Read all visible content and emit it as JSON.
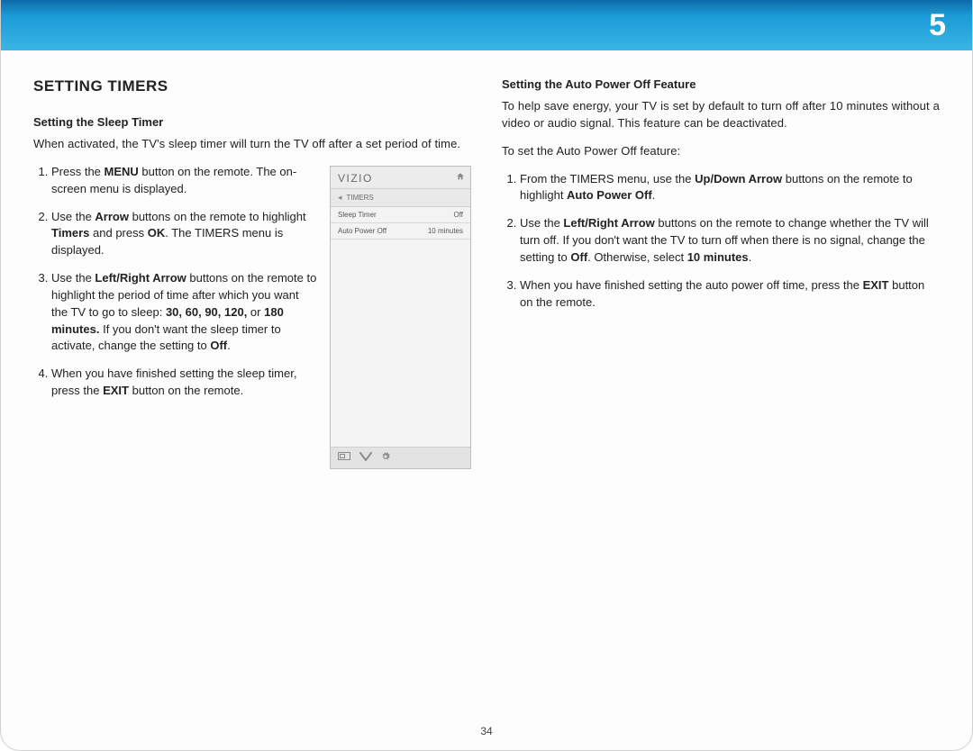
{
  "chapter_number": "5",
  "page_number": "34",
  "section_title": "SETTING TIMERS",
  "left": {
    "subhead": "Setting the Sleep Timer",
    "intro": "When activated, the TV's sleep timer will turn the TV off after a set period of time.",
    "steps": {
      "s1a": "Press the ",
      "s1b": "MENU",
      "s1c": " button on the remote. The on-screen menu is displayed.",
      "s2a": "Use the ",
      "s2b": "Arrow",
      "s2c": " buttons on the remote to highlight ",
      "s2d": "Timers",
      "s2e": " and press ",
      "s2f": "OK",
      "s2g": ". The TIMERS menu is displayed.",
      "s3a": "Use the ",
      "s3b": "Left/Right Arrow",
      "s3c": " buttons on the remote to highlight the period of time after which you want the TV to go to sleep: ",
      "s3d": "30, 60, 90, 120,",
      "s3e": " or ",
      "s3f": "180 minutes.",
      "s3g": " If you don't want the sleep timer to activate, change the setting to ",
      "s3h": "Off",
      "s3i": ".",
      "s4a": "When you have finished setting the sleep timer, press the ",
      "s4b": "EXIT",
      "s4c": " button on the remote."
    }
  },
  "osd": {
    "brand": "VIZIO",
    "crumb": "TIMERS",
    "rows": [
      {
        "label": "Sleep Timer",
        "value": "Off"
      },
      {
        "label": "Auto Power Off",
        "value": "10 minutes"
      }
    ]
  },
  "right": {
    "subhead": "Setting the Auto Power Off Feature",
    "intro": "To help save energy, your TV is set by default to turn off after 10 minutes without a video or audio signal. This feature can be deactivated.",
    "lead": "To set the Auto Power Off feature:",
    "steps": {
      "s1a": "From the TIMERS menu, use the ",
      "s1b": "Up/Down Arrow",
      "s1c": " buttons on the remote to highlight ",
      "s1d": "Auto Power Off",
      "s1e": ".",
      "s2a": "Use the ",
      "s2b": "Left/Right Arrow",
      "s2c": " buttons on the remote to change whether the TV will turn off. If you don't want the TV to turn off when there is no signal, change the setting to ",
      "s2d": "Off",
      "s2e": ". Otherwise, select ",
      "s2f": "10 minutes",
      "s2g": ".",
      "s3a": "When you have finished setting the auto power off time, press the ",
      "s3b": "EXIT",
      "s3c": " button on the remote."
    }
  }
}
